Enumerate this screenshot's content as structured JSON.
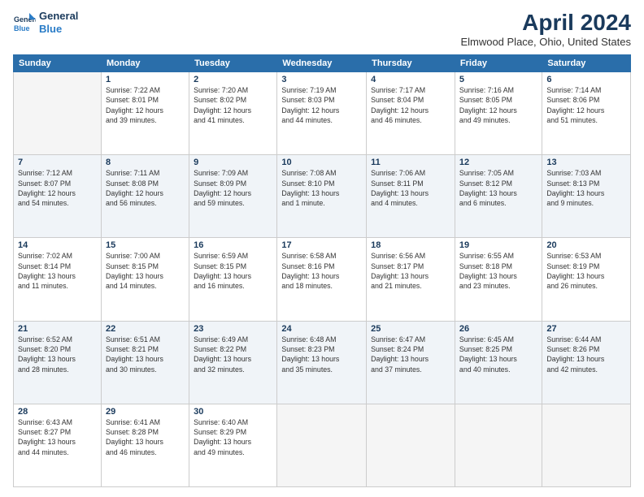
{
  "header": {
    "logo_line1": "General",
    "logo_line2": "Blue",
    "title": "April 2024",
    "subtitle": "Elmwood Place, Ohio, United States"
  },
  "days": [
    "Sunday",
    "Monday",
    "Tuesday",
    "Wednesday",
    "Thursday",
    "Friday",
    "Saturday"
  ],
  "weeks": [
    [
      {
        "date": "",
        "info": ""
      },
      {
        "date": "1",
        "info": "Sunrise: 7:22 AM\nSunset: 8:01 PM\nDaylight: 12 hours\nand 39 minutes."
      },
      {
        "date": "2",
        "info": "Sunrise: 7:20 AM\nSunset: 8:02 PM\nDaylight: 12 hours\nand 41 minutes."
      },
      {
        "date": "3",
        "info": "Sunrise: 7:19 AM\nSunset: 8:03 PM\nDaylight: 12 hours\nand 44 minutes."
      },
      {
        "date": "4",
        "info": "Sunrise: 7:17 AM\nSunset: 8:04 PM\nDaylight: 12 hours\nand 46 minutes."
      },
      {
        "date": "5",
        "info": "Sunrise: 7:16 AM\nSunset: 8:05 PM\nDaylight: 12 hours\nand 49 minutes."
      },
      {
        "date": "6",
        "info": "Sunrise: 7:14 AM\nSunset: 8:06 PM\nDaylight: 12 hours\nand 51 minutes."
      }
    ],
    [
      {
        "date": "7",
        "info": "Sunrise: 7:12 AM\nSunset: 8:07 PM\nDaylight: 12 hours\nand 54 minutes."
      },
      {
        "date": "8",
        "info": "Sunrise: 7:11 AM\nSunset: 8:08 PM\nDaylight: 12 hours\nand 56 minutes."
      },
      {
        "date": "9",
        "info": "Sunrise: 7:09 AM\nSunset: 8:09 PM\nDaylight: 12 hours\nand 59 minutes."
      },
      {
        "date": "10",
        "info": "Sunrise: 7:08 AM\nSunset: 8:10 PM\nDaylight: 13 hours\nand 1 minute."
      },
      {
        "date": "11",
        "info": "Sunrise: 7:06 AM\nSunset: 8:11 PM\nDaylight: 13 hours\nand 4 minutes."
      },
      {
        "date": "12",
        "info": "Sunrise: 7:05 AM\nSunset: 8:12 PM\nDaylight: 13 hours\nand 6 minutes."
      },
      {
        "date": "13",
        "info": "Sunrise: 7:03 AM\nSunset: 8:13 PM\nDaylight: 13 hours\nand 9 minutes."
      }
    ],
    [
      {
        "date": "14",
        "info": "Sunrise: 7:02 AM\nSunset: 8:14 PM\nDaylight: 13 hours\nand 11 minutes."
      },
      {
        "date": "15",
        "info": "Sunrise: 7:00 AM\nSunset: 8:15 PM\nDaylight: 13 hours\nand 14 minutes."
      },
      {
        "date": "16",
        "info": "Sunrise: 6:59 AM\nSunset: 8:15 PM\nDaylight: 13 hours\nand 16 minutes."
      },
      {
        "date": "17",
        "info": "Sunrise: 6:58 AM\nSunset: 8:16 PM\nDaylight: 13 hours\nand 18 minutes."
      },
      {
        "date": "18",
        "info": "Sunrise: 6:56 AM\nSunset: 8:17 PM\nDaylight: 13 hours\nand 21 minutes."
      },
      {
        "date": "19",
        "info": "Sunrise: 6:55 AM\nSunset: 8:18 PM\nDaylight: 13 hours\nand 23 minutes."
      },
      {
        "date": "20",
        "info": "Sunrise: 6:53 AM\nSunset: 8:19 PM\nDaylight: 13 hours\nand 26 minutes."
      }
    ],
    [
      {
        "date": "21",
        "info": "Sunrise: 6:52 AM\nSunset: 8:20 PM\nDaylight: 13 hours\nand 28 minutes."
      },
      {
        "date": "22",
        "info": "Sunrise: 6:51 AM\nSunset: 8:21 PM\nDaylight: 13 hours\nand 30 minutes."
      },
      {
        "date": "23",
        "info": "Sunrise: 6:49 AM\nSunset: 8:22 PM\nDaylight: 13 hours\nand 32 minutes."
      },
      {
        "date": "24",
        "info": "Sunrise: 6:48 AM\nSunset: 8:23 PM\nDaylight: 13 hours\nand 35 minutes."
      },
      {
        "date": "25",
        "info": "Sunrise: 6:47 AM\nSunset: 8:24 PM\nDaylight: 13 hours\nand 37 minutes."
      },
      {
        "date": "26",
        "info": "Sunrise: 6:45 AM\nSunset: 8:25 PM\nDaylight: 13 hours\nand 40 minutes."
      },
      {
        "date": "27",
        "info": "Sunrise: 6:44 AM\nSunset: 8:26 PM\nDaylight: 13 hours\nand 42 minutes."
      }
    ],
    [
      {
        "date": "28",
        "info": "Sunrise: 6:43 AM\nSunset: 8:27 PM\nDaylight: 13 hours\nand 44 minutes."
      },
      {
        "date": "29",
        "info": "Sunrise: 6:41 AM\nSunset: 8:28 PM\nDaylight: 13 hours\nand 46 minutes."
      },
      {
        "date": "30",
        "info": "Sunrise: 6:40 AM\nSunset: 8:29 PM\nDaylight: 13 hours\nand 49 minutes."
      },
      {
        "date": "",
        "info": ""
      },
      {
        "date": "",
        "info": ""
      },
      {
        "date": "",
        "info": ""
      },
      {
        "date": "",
        "info": ""
      }
    ]
  ]
}
